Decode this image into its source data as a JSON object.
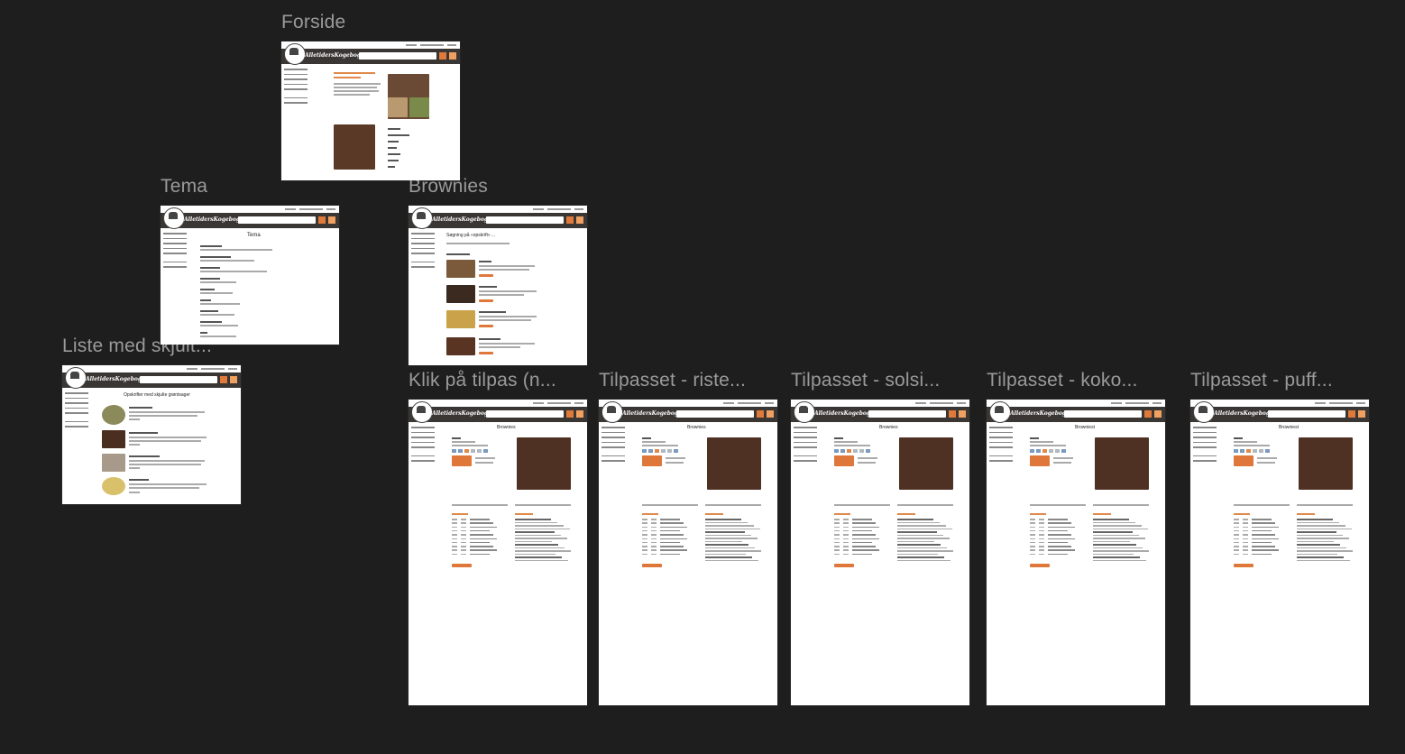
{
  "canvas": {
    "frames": [
      {
        "id": "forside",
        "label": "Forside"
      },
      {
        "id": "tema",
        "label": "Tema"
      },
      {
        "id": "brownies",
        "label": "Brownies"
      },
      {
        "id": "liste",
        "label": "Liste med skjult..."
      },
      {
        "id": "klik",
        "label": "Klik på tilpas (n..."
      },
      {
        "id": "riste",
        "label": "Tilpasset - riste..."
      },
      {
        "id": "solsi",
        "label": "Tilpasset - solsi..."
      },
      {
        "id": "koko",
        "label": "Tilpasset - koko..."
      },
      {
        "id": "puff",
        "label": "Tilpasset - puff..."
      }
    ]
  },
  "colors": {
    "background": "#1e1e1e",
    "header": "#3a3634",
    "accent": "#e07a3a"
  },
  "mock": {
    "brand": "AlletidersKogebog",
    "tema_title": "Tema",
    "brownies_heading": "Søgning på «opskrift» ...",
    "liste_heading": "Opskrifter med skjulte grøntsager",
    "recipe_title": "Brownies",
    "recipe_title_alt": "Browniest"
  },
  "icons": [
    "logo-icon",
    "search-icon",
    "bookmark-icon",
    "rss-icon"
  ]
}
